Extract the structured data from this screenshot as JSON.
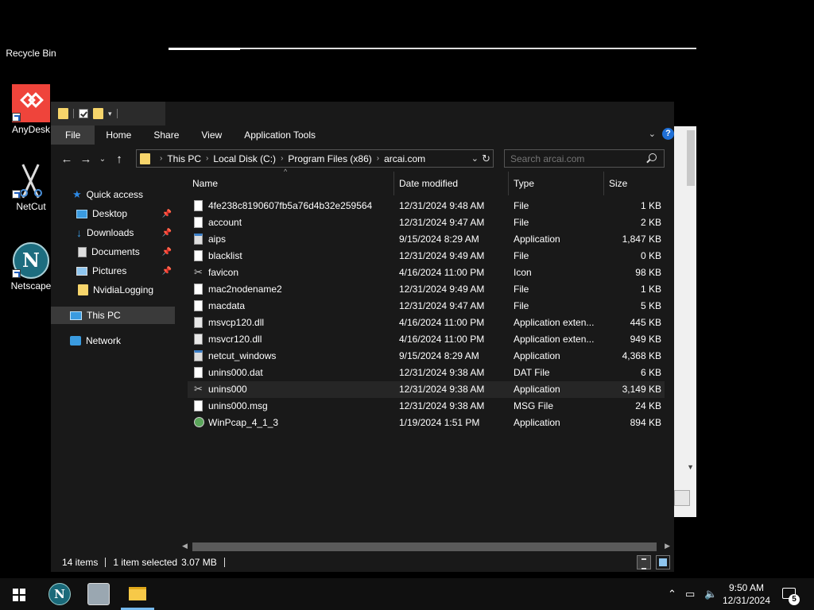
{
  "desktop": {
    "icons": [
      {
        "label": "Recycle Bin"
      },
      {
        "label": "AnyDesk"
      },
      {
        "label": "NetCut"
      },
      {
        "label": "Netscape"
      }
    ]
  },
  "explorer": {
    "ribbon_tabs": [
      "File",
      "Home",
      "Share",
      "View",
      "Application Tools"
    ],
    "help_label": "?",
    "breadcrumb": [
      "This PC",
      "Local Disk (C:)",
      "Program Files (x86)",
      "arcai.com"
    ],
    "search_placeholder": "Search arcai.com",
    "nav": {
      "quick_access": "Quick access",
      "desktop": "Desktop",
      "downloads": "Downloads",
      "documents": "Documents",
      "pictures": "Pictures",
      "nvidia": "NvidiaLogging",
      "this_pc": "This PC",
      "network": "Network"
    },
    "columns": {
      "name": "Name",
      "date": "Date modified",
      "type": "Type",
      "size": "Size"
    },
    "files": [
      {
        "name": "4fe238c8190607fb5a76d4b32e259564",
        "date": "12/31/2024 9:48 AM",
        "type": "File",
        "size": "1 KB",
        "icon": "file-icon"
      },
      {
        "name": "account",
        "date": "12/31/2024 9:47 AM",
        "type": "File",
        "size": "2 KB",
        "icon": "file-icon"
      },
      {
        "name": "aips",
        "date": "9/15/2024 8:29 AM",
        "type": "Application",
        "size": "1,847 KB",
        "icon": "app-icon"
      },
      {
        "name": "blacklist",
        "date": "12/31/2024 9:49 AM",
        "type": "File",
        "size": "0 KB",
        "icon": "file-icon"
      },
      {
        "name": "favicon",
        "date": "4/16/2024 11:00 PM",
        "type": "Icon",
        "size": "98 KB",
        "icon": "scissors-icon"
      },
      {
        "name": "mac2nodename2",
        "date": "12/31/2024 9:49 AM",
        "type": "File",
        "size": "1 KB",
        "icon": "file-icon"
      },
      {
        "name": "macdata",
        "date": "12/31/2024 9:47 AM",
        "type": "File",
        "size": "5 KB",
        "icon": "file-icon"
      },
      {
        "name": "msvcp120.dll",
        "date": "4/16/2024 11:00 PM",
        "type": "Application exten...",
        "size": "445 KB",
        "icon": "dll-icon"
      },
      {
        "name": "msvcr120.dll",
        "date": "4/16/2024 11:00 PM",
        "type": "Application exten...",
        "size": "949 KB",
        "icon": "dll-icon"
      },
      {
        "name": "netcut_windows",
        "date": "9/15/2024 8:29 AM",
        "type": "Application",
        "size": "4,368 KB",
        "icon": "app-icon"
      },
      {
        "name": "unins000.dat",
        "date": "12/31/2024 9:38 AM",
        "type": "DAT File",
        "size": "6 KB",
        "icon": "file-icon"
      },
      {
        "name": "unins000",
        "date": "12/31/2024 9:38 AM",
        "type": "Application",
        "size": "3,149 KB",
        "icon": "scissors-icon"
      },
      {
        "name": "unins000.msg",
        "date": "12/31/2024 9:38 AM",
        "type": "MSG File",
        "size": "24 KB",
        "icon": "file-icon"
      },
      {
        "name": "WinPcap_4_1_3",
        "date": "1/19/2024 1:51 PM",
        "type": "Application",
        "size": "894 KB",
        "icon": "globe-icon"
      }
    ],
    "selected_index": 11,
    "status": {
      "count": "14 items",
      "selection": "1 item selected",
      "size": "3.07 MB"
    }
  },
  "taskbar": {
    "time": "9:50 AM",
    "date": "12/31/2024",
    "notification_count": "5"
  },
  "colors": {
    "accent": "#1f6fd6",
    "selection": "#3a3a3a",
    "folder": "#f7d56b"
  }
}
